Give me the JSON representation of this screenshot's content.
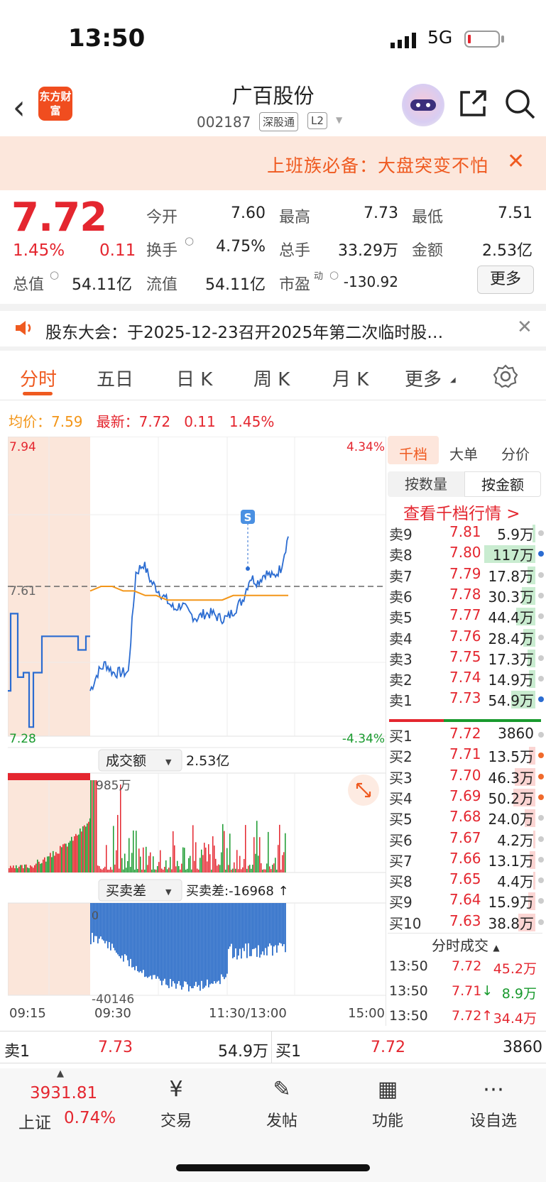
{
  "status_bar": {
    "time": "13:50",
    "network": "5G"
  },
  "header": {
    "logo_text": "东方财富",
    "stock_name": "广百股份",
    "stock_code": "002187",
    "tags": [
      "深股通",
      "L2"
    ]
  },
  "banner": {
    "text": "上班族必备：大盘突变不怕"
  },
  "quote": {
    "price": "7.72",
    "change_pct": "1.45%",
    "change": "0.11",
    "open_label": "今开",
    "open": "7.60",
    "high_label": "最高",
    "high": "7.73",
    "low_label": "最低",
    "low": "7.51",
    "turnover_label": "换手",
    "turnover": "4.75%",
    "volume_label": "总手",
    "volume": "33.29万",
    "amount_label": "金额",
    "amount": "2.53亿",
    "mktcap_label": "总值",
    "mktcap": "54.11亿",
    "float_label": "流值",
    "float": "54.11亿",
    "pe_label": "市盈",
    "pe_sup": "动",
    "pe": "-130.92",
    "more_button": "更多"
  },
  "notice": {
    "text": "股东大会：于2025-12-23召开2025年第二次临时股…"
  },
  "tabs": [
    "分时",
    "五日",
    "日 K",
    "周 K",
    "月 K",
    "更多"
  ],
  "active_tab": "分时",
  "chart_info": {
    "avg_label": "均价：",
    "avg": "7.59",
    "latest_label": "最新：",
    "latest": "7.72",
    "change": "0.11",
    "change_pct": "1.45%"
  },
  "chart_data": [
    {
      "type": "line",
      "title": "",
      "y_top_label": "7.94",
      "y_mid_label": "7.61",
      "y_bot_label": "7.28",
      "pct_top_label": "4.34%",
      "pct_bot_label": "-4.34%",
      "ylim": [
        7.28,
        7.94
      ],
      "prev_close": 7.61,
      "x_ticks": [
        "09:15",
        "09:30",
        "11:30/13:00",
        "15:00"
      ],
      "series": [
        {
          "values": [
            7.38,
            7.42,
            7.44,
            7.42,
            7.42,
            7.42,
            7.64,
            7.66,
            7.62,
            7.6,
            7.58,
            7.56,
            7.57,
            7.55,
            7.54,
            7.55,
            7.55,
            7.54,
            7.54,
            7.56,
            7.58,
            7.63,
            7.62,
            7.64,
            7.63,
            7.65,
            7.72
          ]
        },
        {
          "values": [
            7.6,
            7.61,
            7.61,
            7.6,
            7.6,
            7.59,
            7.59,
            7.58,
            7.58,
            7.58,
            7.58,
            7.58,
            7.58,
            7.59,
            7.59,
            7.59,
            7.59,
            7.59,
            7.59
          ]
        }
      ],
      "marker": "S"
    },
    {
      "type": "bar",
      "title": "成交额",
      "total": "2.53亿",
      "max_label": "985万"
    },
    {
      "type": "bar",
      "title": "买卖差",
      "value_label": "买卖差:-16968 ↑",
      "top_label": "0",
      "min_label": "-40146"
    }
  ],
  "right_panel": {
    "tabs": [
      "千档",
      "大单",
      "分价"
    ],
    "active_tab": "千档",
    "mode_buttons": [
      "按数量",
      "按金额"
    ],
    "active_mode": "按金额",
    "link": "查看千档行情 >",
    "asks": [
      {
        "name": "卖9",
        "price": "7.81",
        "amount": "5.9万",
        "bar": 0.05,
        "dot": "#ccc"
      },
      {
        "name": "卖8",
        "price": "7.80",
        "amount": "117万",
        "bar": 1.0,
        "dot": "#2b6cd1"
      },
      {
        "name": "卖7",
        "price": "7.79",
        "amount": "17.8万",
        "bar": 0.15,
        "dot": "#ccc"
      },
      {
        "name": "卖6",
        "price": "7.78",
        "amount": "30.3万",
        "bar": 0.26,
        "dot": "#ccc"
      },
      {
        "name": "卖5",
        "price": "7.77",
        "amount": "44.4万",
        "bar": 0.38,
        "dot": "#ccc"
      },
      {
        "name": "卖4",
        "price": "7.76",
        "amount": "28.4万",
        "bar": 0.24,
        "dot": "#ccc"
      },
      {
        "name": "卖3",
        "price": "7.75",
        "amount": "17.3万",
        "bar": 0.15,
        "dot": "#ccc"
      },
      {
        "name": "卖2",
        "price": "7.74",
        "amount": "14.9万",
        "bar": 0.13,
        "dot": "#ccc"
      },
      {
        "name": "卖1",
        "price": "7.73",
        "amount": "54.9万",
        "bar": 0.47,
        "dot": "#2b6cd1"
      }
    ],
    "bids": [
      {
        "name": "买1",
        "price": "7.72",
        "amount": "3860",
        "bar": 0.0,
        "dot": "#ccc"
      },
      {
        "name": "买2",
        "price": "7.71",
        "amount": "13.5万",
        "bar": 0.12,
        "dot": "#f06a2c"
      },
      {
        "name": "买3",
        "price": "7.70",
        "amount": "46.3万",
        "bar": 0.4,
        "dot": "#f06a2c"
      },
      {
        "name": "买4",
        "price": "7.69",
        "amount": "50.2万",
        "bar": 0.43,
        "dot": "#f06a2c"
      },
      {
        "name": "买5",
        "price": "7.68",
        "amount": "24.0万",
        "bar": 0.21,
        "dot": "#ccc"
      },
      {
        "name": "买6",
        "price": "7.67",
        "amount": "4.2万",
        "bar": 0.04,
        "dot": "#ccc"
      },
      {
        "name": "买7",
        "price": "7.66",
        "amount": "13.1万",
        "bar": 0.11,
        "dot": "#ccc"
      },
      {
        "name": "买8",
        "price": "7.65",
        "amount": "4.4万",
        "bar": 0.04,
        "dot": "#ccc"
      },
      {
        "name": "买9",
        "price": "7.64",
        "amount": "15.9万",
        "bar": 0.14,
        "dot": "#ccc"
      },
      {
        "name": "买10",
        "price": "7.63",
        "amount": "38.8万",
        "bar": 0.33,
        "dot": "#ccc"
      }
    ],
    "fs_title": "分时成交",
    "fs_rows": [
      {
        "time": "13:50",
        "price": "7.72",
        "arrow": "",
        "amount": "45.2万",
        "color": "#e4262f"
      },
      {
        "time": "13:50",
        "price": "7.71",
        "arrow": "↓",
        "amount": "8.9万",
        "color": "#199a2e"
      },
      {
        "time": "13:50",
        "price": "7.72",
        "arrow": "↑",
        "amount": "34.4万",
        "color": "#e4262f"
      }
    ]
  },
  "bottom_strip": {
    "sell_label": "卖1",
    "sell_price": "7.73",
    "sell_amount": "54.9万",
    "buy_label": "买1",
    "buy_price": "7.72",
    "buy_amount": "3860"
  },
  "bottom_nav": {
    "index_value": "3931.81",
    "index_name": "上证",
    "index_change": "0.74%",
    "items": [
      "交易",
      "发帖",
      "功能",
      "设自选"
    ]
  },
  "colors": {
    "up": "#e4262f",
    "down": "#199a2e",
    "accent": "#ef5a20",
    "price_line": "#2b6cd1",
    "avg_line": "#f39619"
  }
}
